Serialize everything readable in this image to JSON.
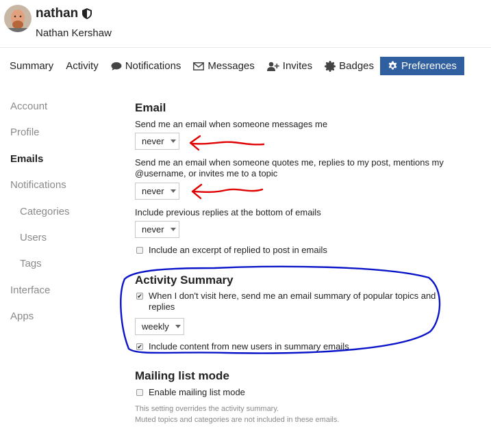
{
  "user": {
    "username": "nathan",
    "full_name": "Nathan Kershaw"
  },
  "tabs": [
    {
      "label": "Summary",
      "icon": ""
    },
    {
      "label": "Activity",
      "icon": ""
    },
    {
      "label": "Notifications",
      "icon": "comment-icon"
    },
    {
      "label": "Messages",
      "icon": "envelope-icon"
    },
    {
      "label": "Invites",
      "icon": "user-plus-icon"
    },
    {
      "label": "Badges",
      "icon": "certificate-icon"
    },
    {
      "label": "Preferences",
      "icon": "gear-icon",
      "active": true
    }
  ],
  "sidebar": {
    "items": [
      {
        "label": "Account"
      },
      {
        "label": "Profile"
      },
      {
        "label": "Emails",
        "current": true
      },
      {
        "label": "Notifications"
      },
      {
        "label": "Categories"
      },
      {
        "label": "Users"
      },
      {
        "label": "Tags"
      },
      {
        "label": "Interface"
      },
      {
        "label": "Apps"
      }
    ]
  },
  "email": {
    "heading": "Email",
    "messages_label": "Send me an email when someone messages me",
    "messages_value": "never",
    "quotes_label_1": "Send me an email when someone quotes me, replies to my post, mentions my",
    "quotes_label_2": "@username, or invites me to a topic",
    "quotes_value": "never",
    "previous_label": "Include previous replies at the bottom of emails",
    "previous_value": "never",
    "excerpt_label": "Include an excerpt of replied to post in emails",
    "excerpt_checked": false
  },
  "activity_summary": {
    "heading": "Activity Summary",
    "summary_label_1": "When I don't visit here, send me an email summary of popular topics and",
    "summary_label_2": "replies",
    "summary_checked": true,
    "frequency_value": "weekly",
    "new_users_label": "Include content from new users in summary emails",
    "new_users_checked": true
  },
  "mailing_list": {
    "heading": "Mailing list mode",
    "enable_label": "Enable mailing list mode",
    "enable_checked": false,
    "note_1": "This setting overrides the activity summary.",
    "note_2": "Muted topics and categories are not included in these emails."
  },
  "colors": {
    "accent": "#2f5f9e",
    "annotation_arrow": "#e00000",
    "annotation_circle": "#0a14c8"
  }
}
